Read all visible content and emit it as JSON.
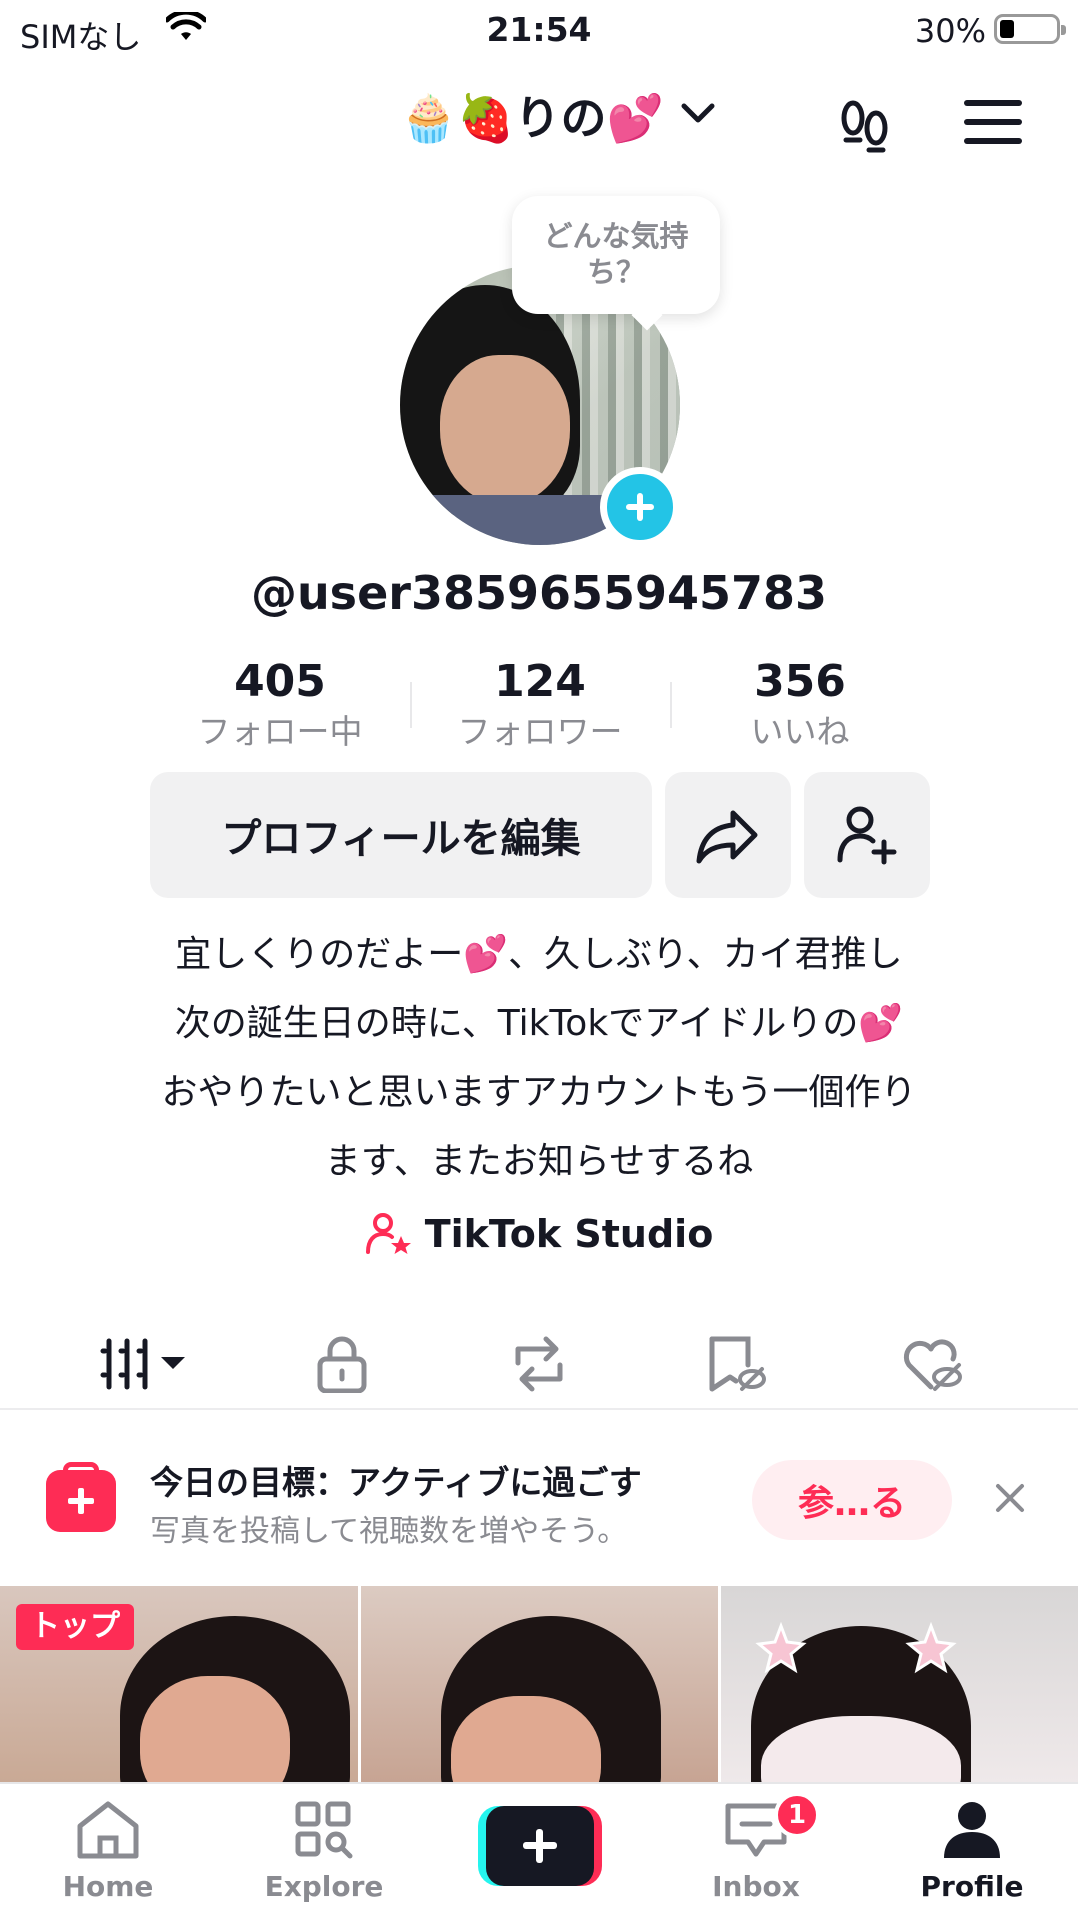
{
  "status_bar": {
    "carrier": "SIMなし",
    "time": "21:54",
    "battery": "30%"
  },
  "header": {
    "account_name": "🧁🍓りの💕"
  },
  "mood_bubble": {
    "text": "どんな気持ち？"
  },
  "profile": {
    "username": "@user3859655945783"
  },
  "stats": [
    {
      "value": "405",
      "label": "フォロー中"
    },
    {
      "value": "124",
      "label": "フォロワー"
    },
    {
      "value": "356",
      "label": "いいね"
    }
  ],
  "actions": {
    "edit_label": "プロフィールを編集"
  },
  "bio": [
    "宜しくりのだよー💕、久しぶり、カイ君推し",
    "次の誕生日の時に、TikTokでアイドルりの💕",
    "おやりたいと思いますアカウントもう一個作り",
    "ます、またお知らせするね"
  ],
  "studio": {
    "label": "TikTok Studio"
  },
  "tabs": [
    "grid-icon",
    "lock-icon",
    "repost-icon",
    "saved-icon",
    "liked-icon"
  ],
  "goal": {
    "title": "今日の目標：アクティブに過ごす",
    "subtitle": "写真を投稿して視聴数を増やそう。",
    "join_label": "参…る"
  },
  "videos": {
    "top_badge": "トップ"
  },
  "bottom_nav": {
    "home": "Home",
    "explore": "Explore",
    "inbox": "Inbox",
    "inbox_count": "1",
    "profile": "Profile"
  },
  "colors": {
    "accent": "#fe2c55",
    "cyan": "#25f4ee",
    "avatar_add": "#23c4e6"
  }
}
